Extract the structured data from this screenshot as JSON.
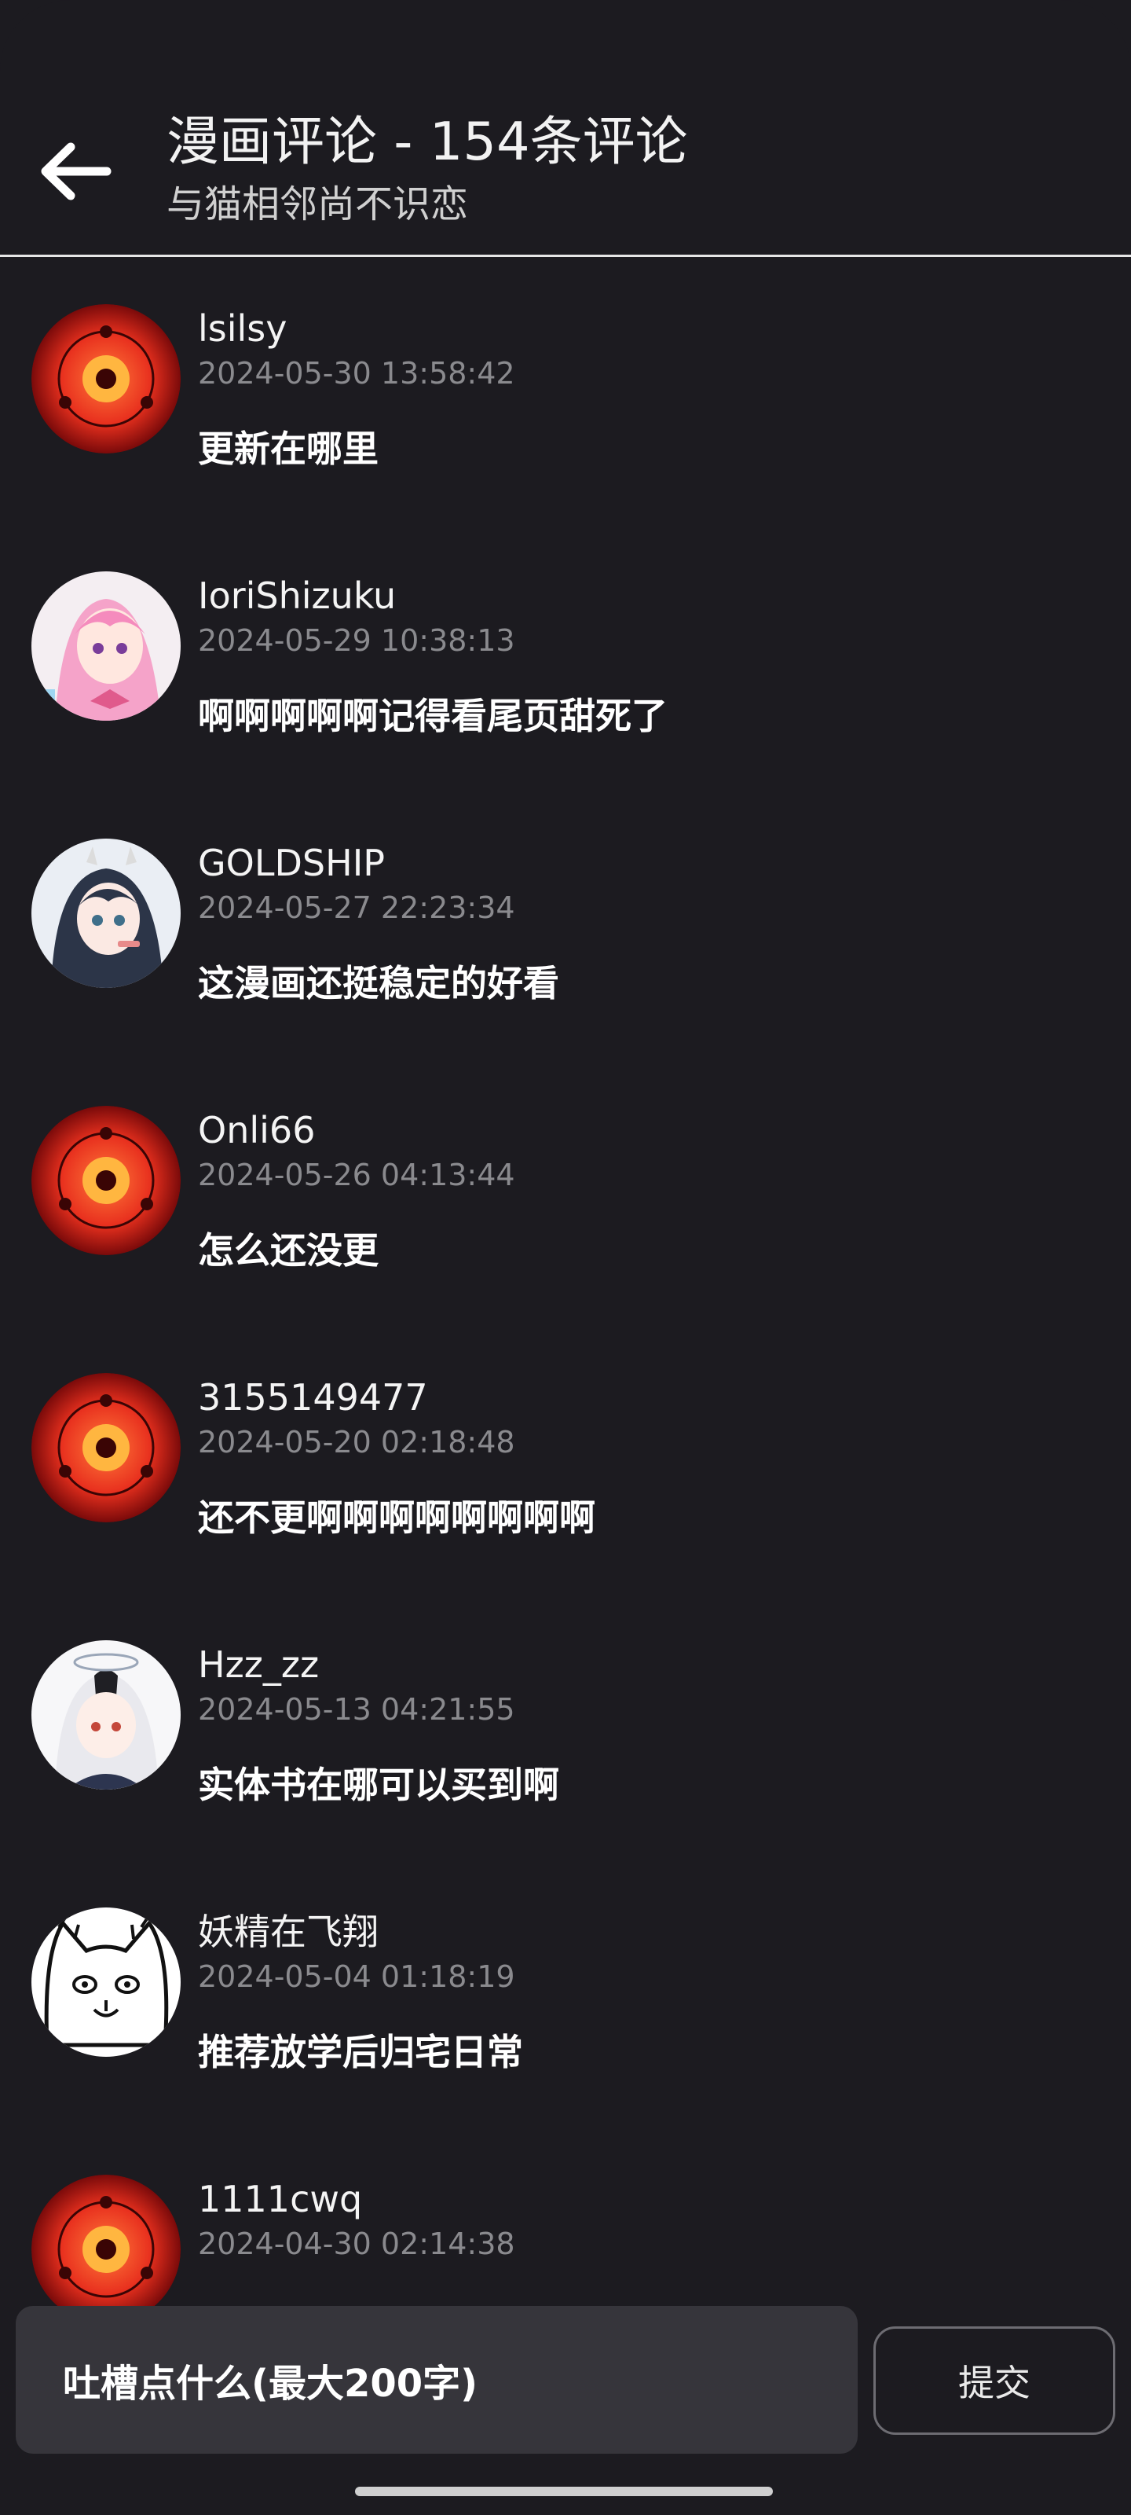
{
  "header": {
    "title": "漫画评论 - 154条评论",
    "subtitle": "与猫相邻尚不识恋",
    "back_icon": "arrow-left-icon"
  },
  "comments": [
    {
      "user": "lsilsy",
      "time": "2024-05-30 13:58:42",
      "text": "更新在哪里",
      "avatar": "sharingan"
    },
    {
      "user": "IoriShizuku",
      "time": "2024-05-29 10:38:13",
      "text": "啊啊啊啊啊记得看尾页甜死了",
      "avatar": "pink-anime-girl"
    },
    {
      "user": "GOLDSHIP",
      "time": "2024-05-27 22:23:34",
      "text": "这漫画还挺稳定的好看",
      "avatar": "dark-hair-anime-girl"
    },
    {
      "user": "Onli66",
      "time": "2024-05-26 04:13:44",
      "text": "怎么还没更",
      "avatar": "sharingan"
    },
    {
      "user": "3155149477",
      "time": "2024-05-20 02:18:48",
      "text": "还不更啊啊啊啊啊啊啊啊",
      "avatar": "sharingan"
    },
    {
      "user": "Hzz_zz",
      "time": "2024-05-13 04:21:55",
      "text": "实体书在哪可以买到啊",
      "avatar": "white-hair-anime-girl"
    },
    {
      "user": "妖精在飞翔",
      "time": "2024-05-04 01:18:19",
      "text": "推荐放学后归宅日常",
      "avatar": "cat-sketch"
    },
    {
      "user": "1111cwq",
      "time": "2024-04-30 02:14:38",
      "text": "",
      "avatar": "sharingan"
    }
  ],
  "input": {
    "placeholder": "吐槽点什么(最大200字)"
  },
  "submit_label": "提交",
  "colors": {
    "background": "#1c1b20",
    "input_bg": "#36353b",
    "time_text": "#8a8a8e"
  }
}
